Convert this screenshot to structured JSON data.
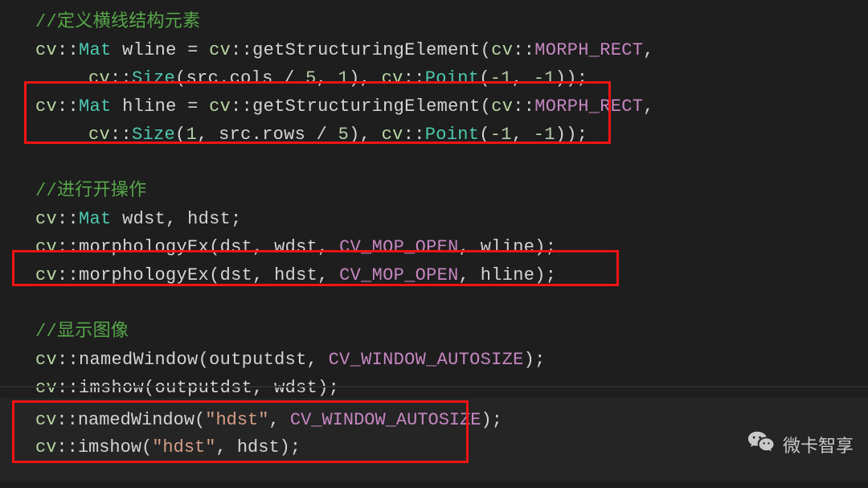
{
  "code": {
    "l1_comment": "//定义横线结构元素",
    "l2": {
      "ns": "cv",
      "type": "Mat",
      "var": "wline",
      "func": "getStructuringElement",
      "macro": "MORPH_RECT"
    },
    "l3": {
      "ns": "cv",
      "size": "Size",
      "arg1a": "src.cols",
      "div": "5",
      "arg1b": "1",
      "point": "Point",
      "pt": "-1",
      "pt2": "-1"
    },
    "l4": {
      "ns": "cv",
      "type": "Mat",
      "var": "hline",
      "func": "getStructuringElement",
      "macro": "MORPH_RECT"
    },
    "l5": {
      "ns": "cv",
      "size": "Size",
      "arg1a": "1",
      "arg1b": "src.rows",
      "div": "5",
      "point": "Point",
      "pt": "-1",
      "pt2": "-1"
    },
    "l6_comment": "//进行开操作",
    "l7": {
      "ns": "cv",
      "type": "Mat",
      "v1": "wdst",
      "v2": "hdst"
    },
    "l8": {
      "ns": "cv",
      "func": "morphologyEx",
      "a1": "dst",
      "a2": "wdst",
      "macro": "CV_MOP_OPEN",
      "a4": "wline"
    },
    "l9": {
      "ns": "cv",
      "func": "morphologyEx",
      "a1": "dst",
      "a2": "hdst",
      "macro": "CV_MOP_OPEN",
      "a4": "hline"
    },
    "l10_comment": "//显示图像",
    "l11": {
      "ns": "cv",
      "func": "namedWindow",
      "a1": "outputdst",
      "macro": "CV_WINDOW_AUTOSIZE"
    },
    "l12": {
      "ns": "cv",
      "func": "imshow",
      "a1": "outputdst",
      "a2": "wdst"
    },
    "l13": {
      "ns": "cv",
      "func": "namedWindow",
      "str": "\"hdst\"",
      "macro": "CV_WINDOW_AUTOSIZE"
    },
    "l14": {
      "ns": "cv",
      "func": "imshow",
      "str": "\"hdst\"",
      "a2": "hdst"
    }
  },
  "watermark": "微卡智享"
}
